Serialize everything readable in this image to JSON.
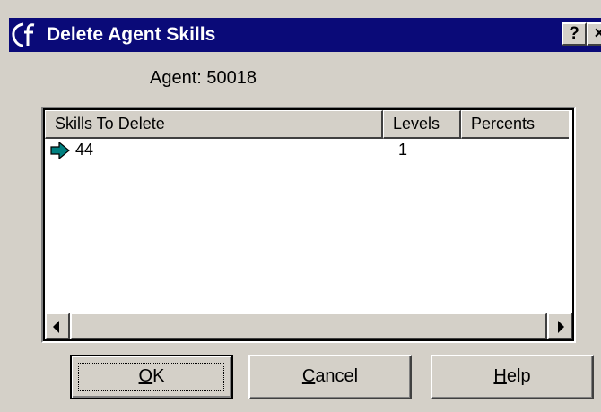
{
  "window": {
    "title": "Delete Agent Skills",
    "help_button": "?",
    "close_button": "×"
  },
  "agent": {
    "label": "Agent:  50018"
  },
  "list": {
    "columns": [
      "Skills To Delete",
      "Levels",
      "Percents"
    ],
    "rows": [
      {
        "icon": "right-arrow-icon",
        "skill": "44",
        "level": "1",
        "percent": ""
      }
    ]
  },
  "buttons": {
    "ok": {
      "mnemonic": "O",
      "rest": "K"
    },
    "cancel": {
      "mnemonic": "C",
      "rest": "ancel"
    },
    "help": {
      "mnemonic": "H",
      "rest": "elp"
    }
  },
  "colors": {
    "titlebar": "#0a0a78",
    "face": "#d4d0c8",
    "arrow_icon": "#008080"
  }
}
